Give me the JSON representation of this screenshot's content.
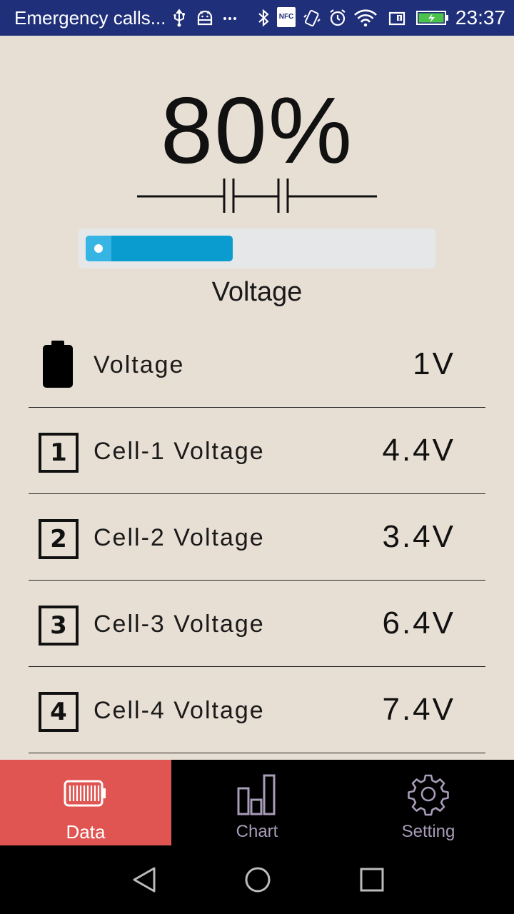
{
  "status_bar": {
    "notification_text": "Emergency calls...",
    "time": "23:37",
    "icons": [
      "usb-icon",
      "android-debug-icon",
      "more-icon",
      "bluetooth-icon",
      "nfc-icon",
      "vibrate-icon",
      "alarm-icon",
      "wifi-icon",
      "sim-alert-icon",
      "battery-charging-icon"
    ],
    "nfc_text": "NFC"
  },
  "header": {
    "percent": "80%",
    "progress_fraction": 0.43,
    "gauge_label": "Voltage"
  },
  "rows": [
    {
      "icon": "battery-icon",
      "label": "Voltage",
      "value": "1V"
    },
    {
      "icon": "cell-1-icon",
      "number": "1",
      "label": "Cell-1 Voltage",
      "value": "4.4V"
    },
    {
      "icon": "cell-2-icon",
      "number": "2",
      "label": "Cell-2 Voltage",
      "value": "3.4V"
    },
    {
      "icon": "cell-3-icon",
      "number": "3",
      "label": "Cell-3 Voltage",
      "value": "6.4V"
    },
    {
      "icon": "cell-4-icon",
      "number": "4",
      "label": "Cell-4 Voltage",
      "value": "7.4V"
    }
  ],
  "tabs": [
    {
      "label": "Data",
      "icon": "battery-tab-icon",
      "active": true
    },
    {
      "label": "Chart",
      "icon": "bar-chart-icon",
      "active": false
    },
    {
      "label": "Setting",
      "icon": "gear-icon",
      "active": false
    }
  ],
  "colors": {
    "background": "#e8dfd4",
    "status_bar": "#1f2f7a",
    "progress_fill": "#0a9ccf",
    "active_tab": "#e05552",
    "inactive_tab_text": "#a89cb8"
  }
}
